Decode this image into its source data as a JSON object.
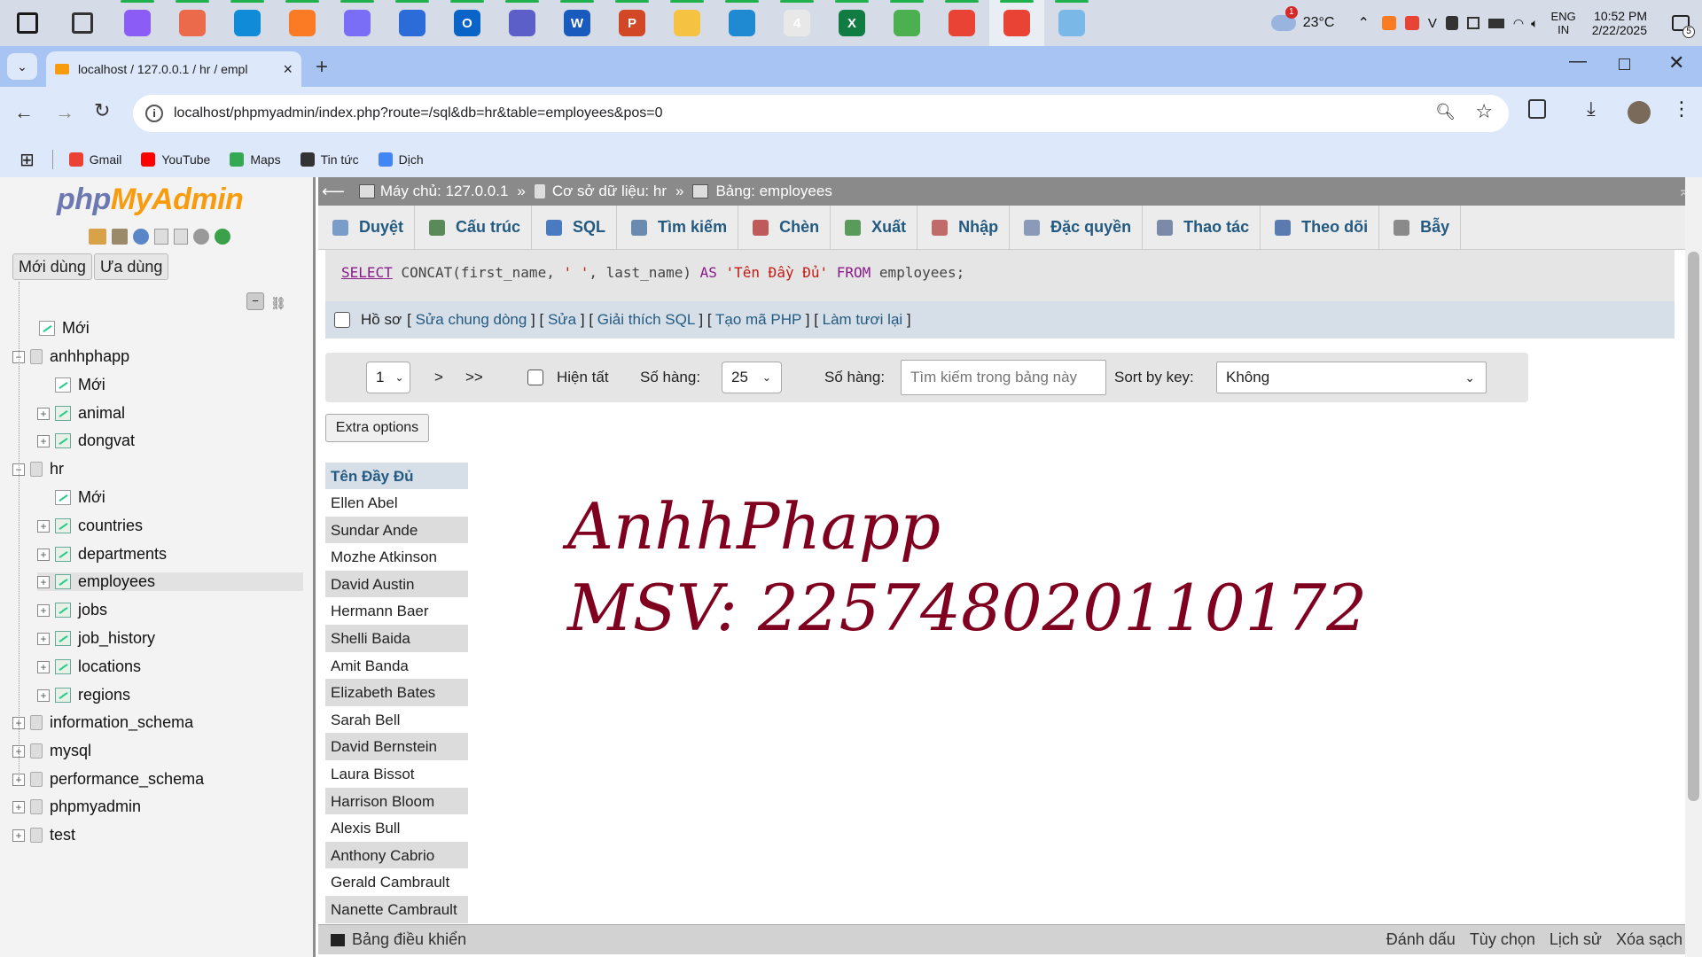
{
  "taskbar": {
    "apps": [
      {
        "icon": "start-icon",
        "label": "",
        "color": "#1a1a1a"
      },
      {
        "icon": "task-view-icon",
        "label": "",
        "color": "#333333"
      },
      {
        "icon": "app-icon",
        "label": "",
        "color": "#8b5cf6"
      },
      {
        "icon": "copilot-icon",
        "label": "",
        "color": "#ea6a4b"
      },
      {
        "icon": "edge-icon",
        "label": "",
        "color": "#0f8bd8"
      },
      {
        "icon": "xampp-icon",
        "label": "",
        "color": "#fb7a24"
      },
      {
        "icon": "app-icon",
        "label": "",
        "color": "#7b6ef6"
      },
      {
        "icon": "store-icon",
        "label": "",
        "color": "#2b6cd8"
      },
      {
        "icon": "outlook-icon",
        "label": "O",
        "color": "#0a64c8"
      },
      {
        "icon": "teams-icon",
        "label": "",
        "color": "#5b5fc7"
      },
      {
        "icon": "word-icon",
        "label": "W",
        "color": "#185abd"
      },
      {
        "icon": "powerpoint-icon",
        "label": "P",
        "color": "#d24726"
      },
      {
        "icon": "file-explorer-icon",
        "label": "",
        "color": "#f5c242"
      },
      {
        "icon": "vscode-icon",
        "label": "",
        "color": "#1f8ad2"
      },
      {
        "icon": "zalo-icon",
        "label": "4",
        "color": "#e8e8e8"
      },
      {
        "icon": "excel-icon",
        "label": "X",
        "color": "#107c41"
      },
      {
        "icon": "app-icon",
        "label": "",
        "color": "#4caf50"
      },
      {
        "icon": "chrome-icon",
        "label": "",
        "color": "#e84335"
      },
      {
        "icon": "chrome-icon",
        "label": "",
        "color": "#e84335"
      },
      {
        "icon": "paint-icon",
        "label": "",
        "color": "#7ab8e8"
      }
    ],
    "weather_badge": "1",
    "temperature": "23°C",
    "language_top": "ENG",
    "language_bottom": "IN",
    "time": "10:52 PM",
    "date": "2/22/2025",
    "notification_count": "5"
  },
  "browser": {
    "tab_title": "localhost / 127.0.0.1 / hr / empl",
    "tab_close": "×",
    "new_tab": "+",
    "url": "localhost/phpmyadmin/index.php?route=/sql&db=hr&table=employees&pos=0",
    "bookmarks": [
      {
        "label": "Gmail",
        "color": "#ea4335"
      },
      {
        "label": "YouTube",
        "color": "#ff0000"
      },
      {
        "label": "Maps",
        "color": "#34a853"
      },
      {
        "label": "Tin tức",
        "color": "#333333"
      },
      {
        "label": "Dịch",
        "color": "#4285f4"
      }
    ]
  },
  "sidebar": {
    "logo_php": "php",
    "logo_myadmin": "MyAdmin",
    "recent_button": "Mới dùng",
    "favorites_button": "Ưa dùng",
    "tree": [
      {
        "label": "Mới",
        "level": 1,
        "kind": "new",
        "toggle": ""
      },
      {
        "label": "anhhphapp",
        "level": 0,
        "kind": "db",
        "toggle": "−"
      },
      {
        "label": "Mới",
        "level": 2,
        "kind": "new",
        "toggle": ""
      },
      {
        "label": "animal",
        "level": 2,
        "kind": "table",
        "toggle": "+"
      },
      {
        "label": "dongvat",
        "level": 2,
        "kind": "table",
        "toggle": "+"
      },
      {
        "label": "hr",
        "level": 0,
        "kind": "db",
        "toggle": "−"
      },
      {
        "label": "Mới",
        "level": 2,
        "kind": "new",
        "toggle": ""
      },
      {
        "label": "countries",
        "level": 2,
        "kind": "table",
        "toggle": "+"
      },
      {
        "label": "departments",
        "level": 2,
        "kind": "table",
        "toggle": "+"
      },
      {
        "label": "employees",
        "level": 2,
        "kind": "table",
        "toggle": "+",
        "selected": true
      },
      {
        "label": "jobs",
        "level": 2,
        "kind": "table",
        "toggle": "+"
      },
      {
        "label": "job_history",
        "level": 2,
        "kind": "table",
        "toggle": "+"
      },
      {
        "label": "locations",
        "level": 2,
        "kind": "table",
        "toggle": "+"
      },
      {
        "label": "regions",
        "level": 2,
        "kind": "table",
        "toggle": "+"
      },
      {
        "label": "information_schema",
        "level": 0,
        "kind": "db",
        "toggle": "+"
      },
      {
        "label": "mysql",
        "level": 0,
        "kind": "db",
        "toggle": "+"
      },
      {
        "label": "performance_schema",
        "level": 0,
        "kind": "db",
        "toggle": "+"
      },
      {
        "label": "phpmyadmin",
        "level": 0,
        "kind": "db",
        "toggle": "+"
      },
      {
        "label": "test",
        "level": 0,
        "kind": "db",
        "toggle": "+"
      }
    ]
  },
  "breadcrumb": {
    "server": "Máy chủ: 127.0.0.1",
    "sep": "»",
    "database": "Cơ sở dữ liệu: hr",
    "table": "Bảng: employees"
  },
  "menu_tabs": [
    {
      "label": "Duyệt",
      "icon": "browse-icon",
      "color": "#7a9cc8"
    },
    {
      "label": "Cấu trúc",
      "icon": "structure-icon",
      "color": "#5a8a5a"
    },
    {
      "label": "SQL",
      "icon": "sql-icon",
      "color": "#4a7ac0"
    },
    {
      "label": "Tìm kiếm",
      "icon": "search-icon",
      "color": "#6a8ab0"
    },
    {
      "label": "Chèn",
      "icon": "insert-icon",
      "color": "#c05a5a"
    },
    {
      "label": "Xuất",
      "icon": "export-icon",
      "color": "#5a9a5a"
    },
    {
      "label": "Nhập",
      "icon": "import-icon",
      "color": "#c06a6a"
    },
    {
      "label": "Đặc quyền",
      "icon": "privileges-icon",
      "color": "#8a9ab8"
    },
    {
      "label": "Thao tác",
      "icon": "operations-icon",
      "color": "#7a8aa8"
    },
    {
      "label": "Theo dõi",
      "icon": "tracking-icon",
      "color": "#5a7ab0"
    },
    {
      "label": "Bẫy",
      "icon": "triggers-icon",
      "color": "#8a8a8a"
    }
  ],
  "sql": {
    "kw_select": "SELECT",
    "func": "CONCAT(first_name, ",
    "str1": "' '",
    "rest1": ", last_name) ",
    "kw_as": "AS",
    "alias": "'Tên Đầy Đủ'",
    "kw_from": "FROM",
    "table": "employees;"
  },
  "profiling": {
    "label": "Hồ sơ",
    "links": [
      "Sửa chung dòng",
      "Sửa",
      "Giải thích SQL",
      "Tạo mã PHP",
      "Làm tươi lại"
    ]
  },
  "navigation": {
    "page": "1",
    "next": ">",
    "last": ">>",
    "show_all": "Hiện tất",
    "rows_label": "Số hàng:",
    "rows_value": "25",
    "filter_label": "Số hàng:",
    "filter_placeholder": "Tìm kiếm trong bảng này",
    "sort_label": "Sort by key:",
    "sort_value": "Không"
  },
  "extra_options": "Extra options",
  "results": {
    "column": "Tên Đầy Đủ",
    "rows": [
      "Ellen Abel",
      "Sundar Ande",
      "Mozhe Atkinson",
      "David Austin",
      "Hermann Baer",
      "Shelli Baida",
      "Amit Banda",
      "Elizabeth Bates",
      "Sarah Bell",
      "David Bernstein",
      "Laura Bissot",
      "Harrison Bloom",
      "Alexis Bull",
      "Anthony Cabrio",
      "Gerald Cambrault",
      "Nanette Cambrault"
    ]
  },
  "overlay": {
    "line1": "AnhhPhapp",
    "line2": "MSV: 22574802011017​2"
  },
  "console": {
    "label": "Bảng điều khiển",
    "actions": [
      "Đánh dấu",
      "Tùy chọn",
      "Lịch sử",
      "Xóa sạch"
    ]
  }
}
